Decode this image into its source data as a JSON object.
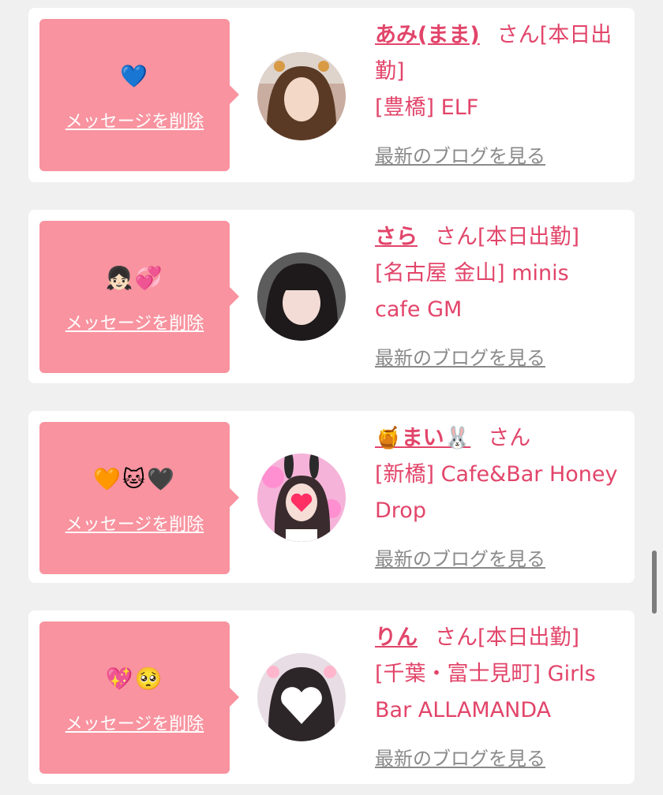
{
  "cards": [
    {
      "emoji": "💙",
      "delete_label": "メッセージを削除",
      "name": "あみ(まま)",
      "suffix": "さん[本日出勤]",
      "shop": "[豊橋] ELF",
      "blog_label": "最新のブログを見る"
    },
    {
      "emoji": "👧🏻💞",
      "delete_label": "メッセージを削除",
      "name": "さら",
      "suffix": "さん[本日出勤]",
      "shop": "[名古屋 金山] minis cafe GM",
      "blog_label": "最新のブログを見る"
    },
    {
      "emoji": "🧡🐱🖤",
      "delete_label": "メッセージを削除",
      "name": "🍯まい🐰",
      "suffix": "さん",
      "shop": "[新橋] Cafe&Bar Honey Drop",
      "blog_label": "最新のブログを見る"
    },
    {
      "emoji": "💖🥺",
      "delete_label": "メッセージを削除",
      "name": "りん",
      "suffix": "さん[本日出勤]",
      "shop": "[千葉・富士見町] Girls Bar ALLAMANDA",
      "blog_label": "最新のブログを見る"
    }
  ],
  "colors": {
    "page_bg": "#f0f0f0",
    "card_bg": "#ffffff",
    "bubble": "#f8939f",
    "accent": "#e2456a",
    "link_gray": "#8a8a8a"
  }
}
